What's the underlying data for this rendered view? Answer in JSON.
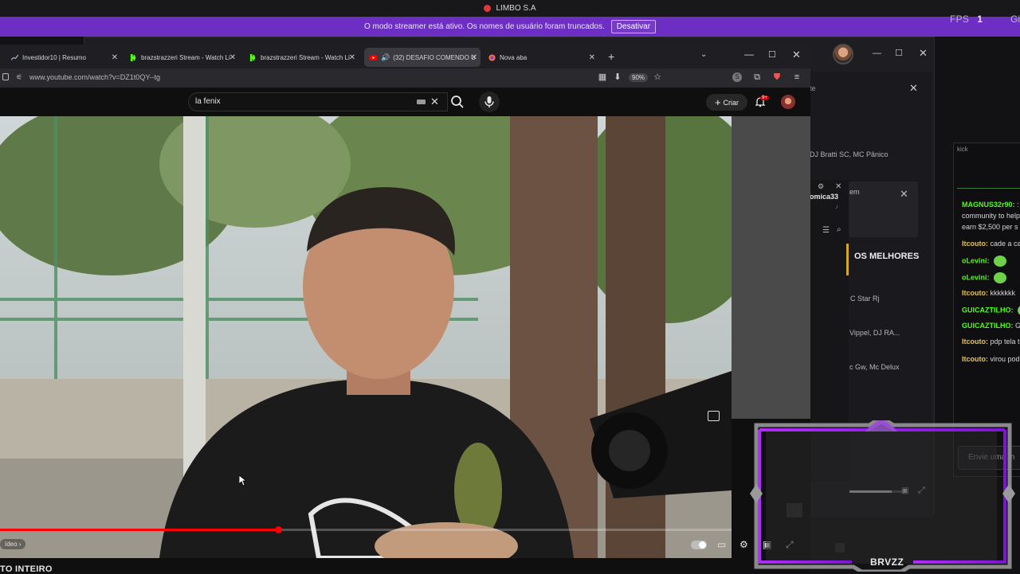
{
  "os": {
    "app_title": "LIMBO S.A",
    "fps_label": "FPS",
    "fps_value": "1",
    "right_cut": "Gi"
  },
  "banner": {
    "message": "O modo streamer está ativo. Os nomes de usuário foram truncados.",
    "button": "Desativar"
  },
  "browser": {
    "tabs": [
      {
        "label": "Investidor10 | Resumo",
        "favicon": "chart-favicon",
        "color": "#7f8fa6"
      },
      {
        "label": "brazstrazzeri Stream - Watch Li",
        "favicon": "kick-favicon",
        "color": "#53fc18"
      },
      {
        "label": "brazstrazzeri Stream - Watch Li",
        "favicon": "kick-favicon",
        "color": "#53fc18"
      },
      {
        "label": "(32) DESAFIO COMENDO U",
        "favicon": "youtube-favicon",
        "color": "#ff0000",
        "active": true
      },
      {
        "label": "Nova aba",
        "favicon": "firefox-favicon",
        "color": "#ff7139"
      }
    ],
    "url": "www.youtube.com/watch?v=DZ1t0QY--tg",
    "zoom": "90%"
  },
  "youtube": {
    "search_value": "la fenix",
    "create_label": "Criar",
    "notification_count": "9+",
    "chapter_label": "ídeo",
    "below_title": "TO INTEIRO"
  },
  "video_progress": 0.38,
  "background_window": {
    "panel_text_te": "te",
    "djs_line": "DJ Bratti SC, MC Pânico",
    "mini_user": "omica33",
    "em_label": "em",
    "section_title": "OS MELHORES",
    "artists": [
      "C Star Rj",
      "Vippel, DJ RA...",
      "c Gw, Mc Delux"
    ]
  },
  "chat": {
    "title": "kick",
    "messages": [
      {
        "user": "MAGNUS32r90:",
        "text": ":",
        "user_color": "green"
      },
      {
        "user": "",
        "text": "community to help"
      },
      {
        "user": "",
        "text": "earn $2,500 per s"
      },
      {
        "user": "Itcouto:",
        "text": "cade a ca",
        "user_color": "yellow"
      },
      {
        "user": "oLevini:",
        "text": "",
        "user_color": "green",
        "emote": true
      },
      {
        "user": "oLevini:",
        "text": "",
        "user_color": "green",
        "emote": true
      },
      {
        "user": "Itcouto:",
        "text": "kkkkkkk",
        "user_color": "yellow"
      },
      {
        "user": "GUICAZTILHO:",
        "text": "",
        "user_color": "green",
        "emote": true
      },
      {
        "user": "GUICAZTILHO:",
        "text": "G",
        "user_color": "green"
      },
      {
        "user": "Itcouto:",
        "text": "pdp tela t",
        "user_color": "yellow"
      },
      {
        "user": "Itcouto:",
        "text": "virou pod",
        "user_color": "yellow"
      }
    ],
    "input_placeholder": "Envie uma m"
  },
  "overlay": {
    "name": "BRVZZ",
    "accent": "#a020f0"
  },
  "colors": {
    "banner": "#6d2ec3",
    "yt_red": "#ff0000",
    "kick_green": "#53fc18"
  }
}
